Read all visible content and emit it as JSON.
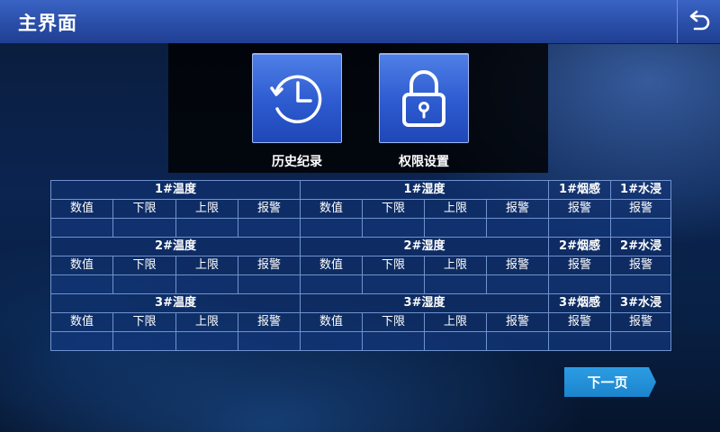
{
  "header": {
    "title": "主界面",
    "back_icon": "return-arrow-icon"
  },
  "menu": {
    "history": {
      "label": "历史纪录",
      "icon": "clock-history-icon"
    },
    "permission": {
      "label": "权限设置",
      "icon": "padlock-icon"
    }
  },
  "groups": [
    {
      "temp": "1#温度",
      "humidity": "1#湿度",
      "smoke": "1#烟感",
      "water": "1#水浸"
    },
    {
      "temp": "2#温度",
      "humidity": "2#湿度",
      "smoke": "2#烟感",
      "water": "2#水浸"
    },
    {
      "temp": "3#温度",
      "humidity": "3#湿度",
      "smoke": "3#烟感",
      "water": "3#水浸"
    }
  ],
  "columns": {
    "value": "数值",
    "lower": "下限",
    "upper": "上限",
    "alarm": "报警"
  },
  "footer": {
    "next_label": "下一页"
  },
  "colors": {
    "header": "#2a4ea8",
    "tile": "#2d5bd0",
    "next_button": "#1b84cc",
    "grid_border": "#6f93cf"
  }
}
